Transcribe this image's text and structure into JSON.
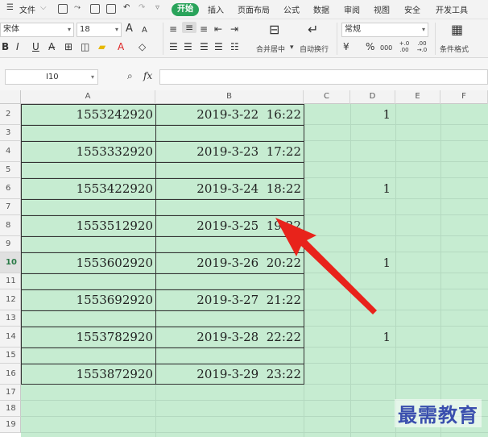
{
  "menubar": {
    "file_label": "文件",
    "tabs": [
      "开始",
      "插入",
      "页面布局",
      "公式",
      "数据",
      "审阅",
      "视图",
      "安全",
      "开发工具"
    ]
  },
  "ribbon": {
    "font_name": "宋体",
    "font_size": "18",
    "number_format": "常规",
    "merge_label": "合并居中",
    "wrap_label": "自动换行",
    "cond_format_label": "条件格式",
    "percent": "%",
    "font_grow": "A",
    "font_shrink": "A",
    "bold": "B",
    "italic": "I",
    "underline": "U",
    "comma_style": "000",
    "inc_decimal": "+.0 .00",
    "dec_decimal": ".00 →.0"
  },
  "formula_bar": {
    "cell_ref": "I10",
    "fx_label": "fx",
    "value": ""
  },
  "columns": [
    "A",
    "B",
    "C",
    "D",
    "E",
    "F"
  ],
  "rows": [
    {
      "num": "2",
      "a": "1553242920",
      "b": "2019-3-22  16:22",
      "d": "1"
    },
    {
      "num": "3",
      "a": "",
      "b": "",
      "d": ""
    },
    {
      "num": "4",
      "a": "1553332920",
      "b": "2019-3-23  17:22",
      "d": ""
    },
    {
      "num": "5",
      "a": "",
      "b": "",
      "d": ""
    },
    {
      "num": "6",
      "a": "1553422920",
      "b": "2019-3-24  18:22",
      "d": "1"
    },
    {
      "num": "7",
      "a": "",
      "b": "",
      "d": ""
    },
    {
      "num": "8",
      "a": "1553512920",
      "b": "2019-3-25  19:22",
      "d": ""
    },
    {
      "num": "9",
      "a": "",
      "b": "",
      "d": ""
    },
    {
      "num": "10",
      "a": "1553602920",
      "b": "2019-3-26  20:22",
      "d": "1"
    },
    {
      "num": "11",
      "a": "",
      "b": "",
      "d": ""
    },
    {
      "num": "12",
      "a": "1553692920",
      "b": "2019-3-27  21:22",
      "d": ""
    },
    {
      "num": "13",
      "a": "",
      "b": "",
      "d": ""
    },
    {
      "num": "14",
      "a": "1553782920",
      "b": "2019-3-28  22:22",
      "d": "1"
    },
    {
      "num": "15",
      "a": "",
      "b": "",
      "d": ""
    },
    {
      "num": "16",
      "a": "1553872920",
      "b": "2019-3-29  23:22",
      "d": ""
    },
    {
      "num": "17",
      "a": "",
      "b": "",
      "d": ""
    },
    {
      "num": "18",
      "a": "",
      "b": "",
      "d": ""
    },
    {
      "num": "19",
      "a": "",
      "b": "",
      "d": ""
    }
  ],
  "active_row": "10",
  "watermark": "最需教育",
  "colors": {
    "start_tab": "#29a35a",
    "cell_fill": "#c6ecd1",
    "arrow": "#e8231b",
    "watermark": "#3a4fae"
  }
}
